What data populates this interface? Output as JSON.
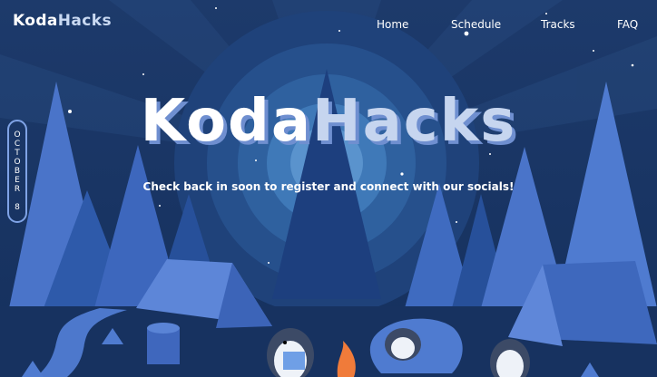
{
  "brand": {
    "part1": "Koda",
    "part2": "Hacks"
  },
  "nav": {
    "items": [
      "Home",
      "Schedule",
      "Tracks",
      "FAQ"
    ]
  },
  "hero": {
    "title_part1": "Koda",
    "title_part2": "Hacks",
    "subtitle": "Check back in soon to register and connect with our socials!",
    "date_badge": "OCTOBER 8"
  },
  "colors": {
    "sky": "#1a3768",
    "glow": "#4f86c6",
    "tree_light": "#4a74c9",
    "tree_dark": "#1d3f7e",
    "tent": "#5d86d8",
    "fire": "#f07b3a"
  }
}
